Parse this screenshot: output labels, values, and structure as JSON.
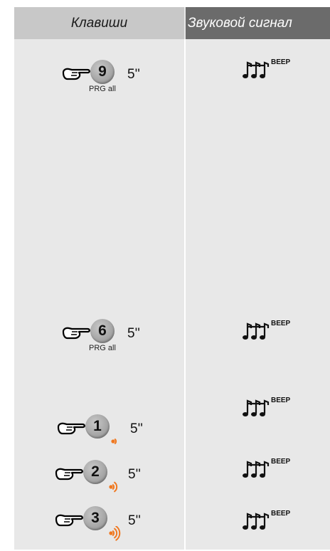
{
  "header": {
    "keys_label": "Клавиши",
    "sound_label": "Звуковой сигнал"
  },
  "rows": [
    {
      "key": "9",
      "time": "5''",
      "sub": "PRG all",
      "beep": "BEEP",
      "signal_bars": 0
    },
    {
      "key": "6",
      "time": "5''",
      "sub": "PRG all",
      "beep": "BEEP",
      "signal_bars": 0
    },
    {
      "key": "1",
      "time": "5''",
      "sub": "",
      "beep": "BEEP",
      "signal_bars": 1
    },
    {
      "key": "2",
      "time": "5''",
      "sub": "",
      "beep": "BEEP",
      "signal_bars": 2
    },
    {
      "key": "3",
      "time": "5''",
      "sub": "",
      "beep": "BEEP",
      "signal_bars": 3
    }
  ],
  "colors": {
    "signal": "#f07820",
    "left_bg": "#e8e8e8",
    "header_left": "#c8c8c8",
    "header_right": "#6b6b6b"
  }
}
